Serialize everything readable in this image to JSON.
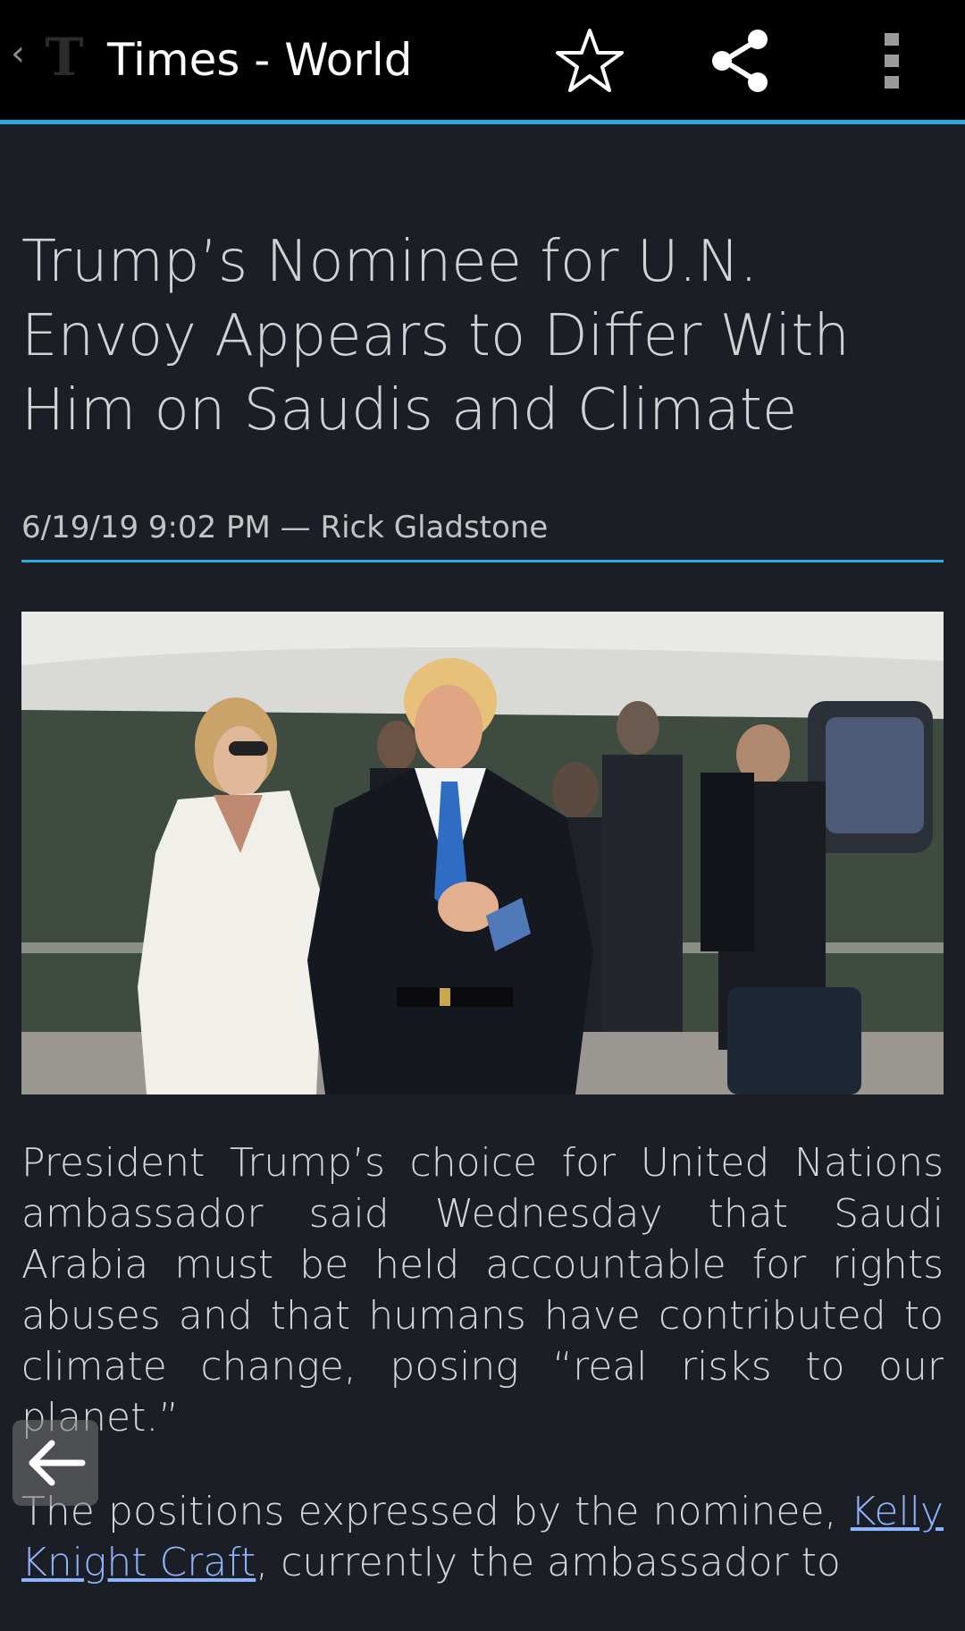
{
  "appbar": {
    "up_glyph": "‹",
    "logo_glyph": "T",
    "title": "Times - World",
    "actions": {
      "star_icon": "star-outline-icon",
      "share_icon": "share-icon",
      "overflow_icon": "more-vert-icon"
    },
    "accent": "#2aa8e0"
  },
  "article": {
    "headline": "Trump’s Nominee for U.N. Envoy Appears to Differ With Him on Saudis and Climate",
    "byline": "6/19/19 9:02 PM — Rick Gladstone",
    "paragraph1": "President Trump’s choice for United Nations ambassador said Wednesday that Saudi Arabia must be held accountable for rights abuses and that humans have contributed to climate change, posing “real risks to our planet.”",
    "paragraph2_before": "The positions expressed by the nominee, ",
    "paragraph2_link": "Kelly Knight Craft",
    "paragraph2_after": ", currently the ambassador to"
  },
  "floating": {
    "back_icon": "arrow-left-icon"
  },
  "colors": {
    "background": "#1b1e24",
    "appbar": "#000000",
    "link": "#8fb4ff"
  }
}
